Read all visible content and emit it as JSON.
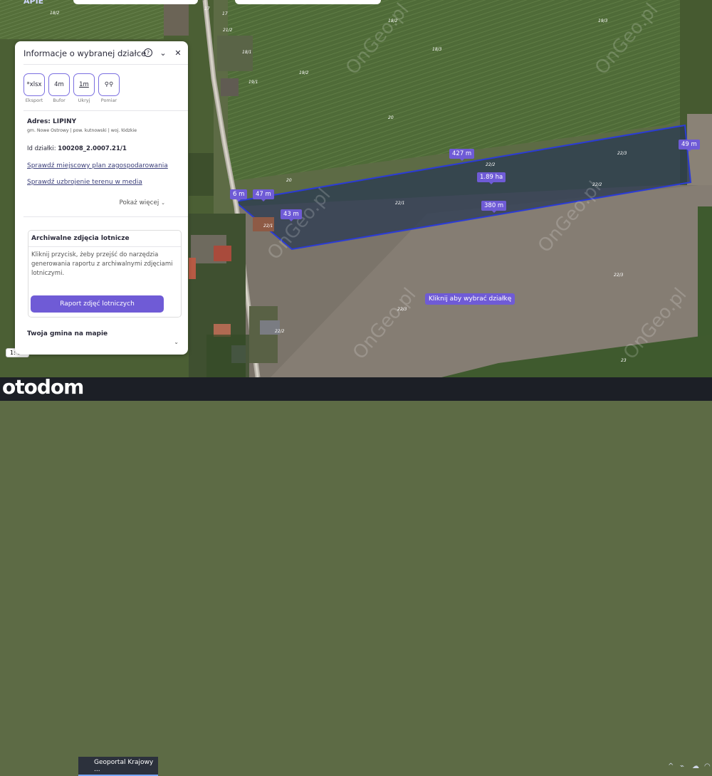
{
  "map": {
    "brand_partial": "APIE",
    "scale": "1: 10",
    "hint": "Kliknij aby wybrać działkę",
    "watermark": "OnGeo.pl",
    "measurements": [
      "427 m",
      "49 m",
      "1.89 ha",
      "380 m",
      "43 m",
      "47 m",
      "6 m"
    ],
    "parcel_numbers": [
      "18/2",
      "18/2",
      "19/3",
      "18/3",
      "18/1",
      "19/2",
      "19/1",
      "20",
      "20",
      "22/3",
      "22/2",
      "22/2",
      "22/3",
      "22/3",
      "22/1",
      "17",
      "17",
      "23",
      "22/1",
      "22/2",
      "21/2"
    ]
  },
  "panel": {
    "title": "Informacje o wybranej działce",
    "icons": [
      "help-icon",
      "chevron-down-icon",
      "close-icon"
    ],
    "tools": [
      {
        "icon": "*xlsx",
        "caption": "Eksport"
      },
      {
        "icon": "4m",
        "caption": "Bufor"
      },
      {
        "icon": "1m",
        "caption": "Ukryj"
      },
      {
        "icon": "⚲⚲",
        "caption": "Pomiar"
      }
    ],
    "address": "Adres: LIPINY",
    "address_sub": "gm. Nowe Ostrowy | pow. kutnowski | woj. łódzkie",
    "plot_id_label": "Id działki: ",
    "plot_id": "100208_2.0007.21/1",
    "link1": "Sprawdź miejscowy plan zagospodarowania",
    "link2": "Sprawdź uzbrojenie terenu w media",
    "more": "Pokaż więcej",
    "card": {
      "title": "Archiwalne zdjęcia lotnicze",
      "desc": "Kliknij przycisk, żeby przejść do narzędzia generowania raportu z archiwalnymi zdjęciami lotniczymi.",
      "button": "Raport zdjęć lotniczych"
    },
    "gmina": "Twoja gmina na mapie"
  },
  "taskbar": {
    "overlay_logo": "otodom",
    "app": "Geoportal Krajowy ..."
  },
  "colors": {
    "accent": "#6f5bd6",
    "parcel_outline": "#2b3bd6"
  }
}
